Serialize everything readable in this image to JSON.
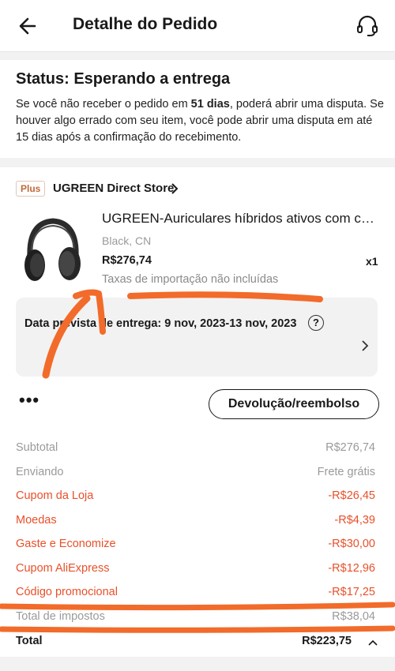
{
  "header": {
    "title": "Detalhe do Pedido",
    "back_icon": "arrow-left-icon",
    "support_icon": "headset-icon"
  },
  "status": {
    "title": "Status: Esperando a entrega",
    "desc_part1": "Se você não receber o pedido em ",
    "days": "51 dias",
    "desc_part2": ", poderá abrir uma disputa. Se houver algo errado com seu item, você pode abrir uma disputa em até 15 dias após a confirmação do recebimento."
  },
  "store": {
    "badge": "Plus",
    "name": "UGREEN Direct Store"
  },
  "product": {
    "title": "UGREEN-Auriculares híbridos ativos com cancelamento de ruído",
    "variant": "Black, CN",
    "price": "R$276,74",
    "quantity": "x1",
    "tax_note": "Taxas de importação não incluídas"
  },
  "delivery": {
    "label": "Data prevista de entrega: 9 nov, 2023-13 nov, 2023",
    "help": "?"
  },
  "actions": {
    "more": "•••",
    "refund_label": "Devolução/reembolso"
  },
  "summary": [
    {
      "label": "Subtotal",
      "value": "R$276,74",
      "style": "gray"
    },
    {
      "label": "Enviando",
      "value": "Frete grátis",
      "style": "gray"
    },
    {
      "label": "Cupom da Loja",
      "value": "-R$26,45",
      "style": "orange"
    },
    {
      "label": "Moedas",
      "value": "-R$4,39",
      "style": "orange"
    },
    {
      "label": "Gaste e Economize",
      "value": "-R$30,00",
      "style": "orange"
    },
    {
      "label": "Cupom AliExpress",
      "value": "-R$12,96",
      "style": "orange"
    },
    {
      "label": "Código promocional",
      "value": "-R$17,25",
      "style": "orange"
    },
    {
      "label": "Total de impostos",
      "value": "R$38,04",
      "style": "gray"
    },
    {
      "label": "Total",
      "value": "R$223,75",
      "style": "total"
    }
  ],
  "colors": {
    "accent": "#e8502a",
    "annotation": "#f26b2a",
    "muted": "#9a9a9a"
  }
}
